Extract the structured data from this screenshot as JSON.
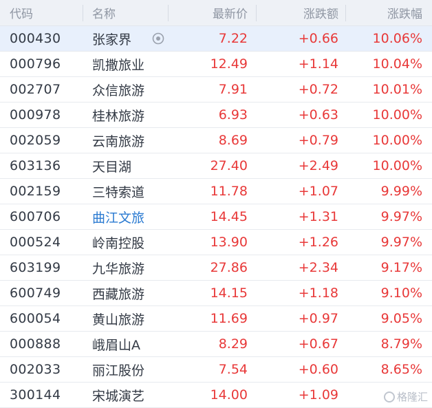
{
  "header": {
    "code": "代码",
    "name": "名称",
    "price": "最新价",
    "change": "涨跌额",
    "pct": "涨跌幅"
  },
  "rows": [
    {
      "code": "000430",
      "name": "张家界",
      "price": "7.22",
      "change": "+0.66",
      "pct": "10.06%",
      "selected": true,
      "icon": "eye-icon"
    },
    {
      "code": "000796",
      "name": "凯撒旅业",
      "price": "12.49",
      "change": "+1.14",
      "pct": "10.04%"
    },
    {
      "code": "002707",
      "name": "众信旅游",
      "price": "7.91",
      "change": "+0.72",
      "pct": "10.01%"
    },
    {
      "code": "000978",
      "name": "桂林旅游",
      "price": "6.93",
      "change": "+0.63",
      "pct": "10.00%"
    },
    {
      "code": "002059",
      "name": "云南旅游",
      "price": "8.69",
      "change": "+0.79",
      "pct": "10.00%"
    },
    {
      "code": "603136",
      "name": "天目湖",
      "price": "27.40",
      "change": "+2.49",
      "pct": "10.00%"
    },
    {
      "code": "002159",
      "name": "三特索道",
      "price": "11.78",
      "change": "+1.07",
      "pct": "9.99%"
    },
    {
      "code": "600706",
      "name": "曲江文旅",
      "price": "14.45",
      "change": "+1.31",
      "pct": "9.97%",
      "link": true
    },
    {
      "code": "000524",
      "name": "岭南控股",
      "price": "13.90",
      "change": "+1.26",
      "pct": "9.97%"
    },
    {
      "code": "603199",
      "name": "九华旅游",
      "price": "27.86",
      "change": "+2.34",
      "pct": "9.17%"
    },
    {
      "code": "600749",
      "name": "西藏旅游",
      "price": "14.15",
      "change": "+1.18",
      "pct": "9.10%"
    },
    {
      "code": "600054",
      "name": "黄山旅游",
      "price": "11.69",
      "change": "+0.97",
      "pct": "9.05%"
    },
    {
      "code": "000888",
      "name": "峨眉山A",
      "price": "8.29",
      "change": "+0.67",
      "pct": "8.79%"
    },
    {
      "code": "002033",
      "name": "丽江股份",
      "price": "7.54",
      "change": "+0.60",
      "pct": "8.65%"
    },
    {
      "code": "300144",
      "name": "宋城演艺",
      "price": "14.00",
      "change": "+1.09",
      "pct": ""
    }
  ],
  "colors": {
    "up": "#e83838",
    "header_bg": "#eef1f6",
    "selected_bg": "#e8f0fc",
    "link": "#2a7ad1"
  },
  "watermark": "格隆汇"
}
